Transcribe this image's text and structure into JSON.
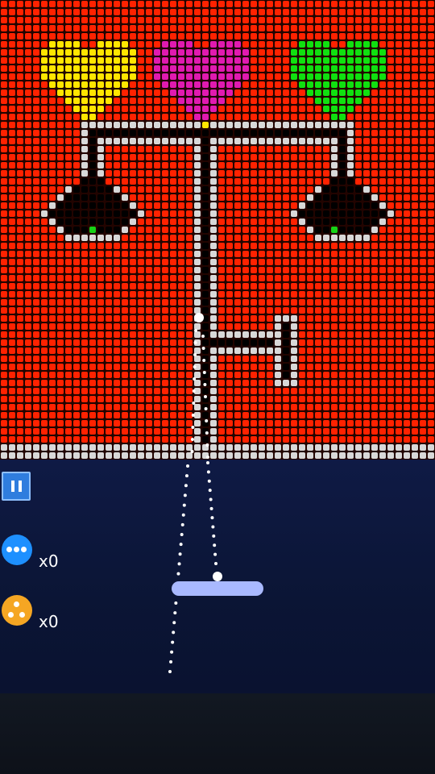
{
  "game": {
    "colors": {
      "empty_cell": "#ff2200",
      "wall": "#d8d8d8",
      "hollow": "#000000",
      "heart_left": "#ffe600",
      "heart_middle": "#e01ab0",
      "heart_right": "#10e010",
      "gem": "#17d317",
      "paddle": "#a9b9ff",
      "ball": "#ffffff"
    },
    "powerups": [
      {
        "icon": "multi-ball-icon",
        "count": "x0",
        "color": "#1e90ff"
      },
      {
        "icon": "split-ball-icon",
        "count": "x0",
        "color": "#f5a623"
      }
    ],
    "pause_icon": "pause-icon"
  }
}
